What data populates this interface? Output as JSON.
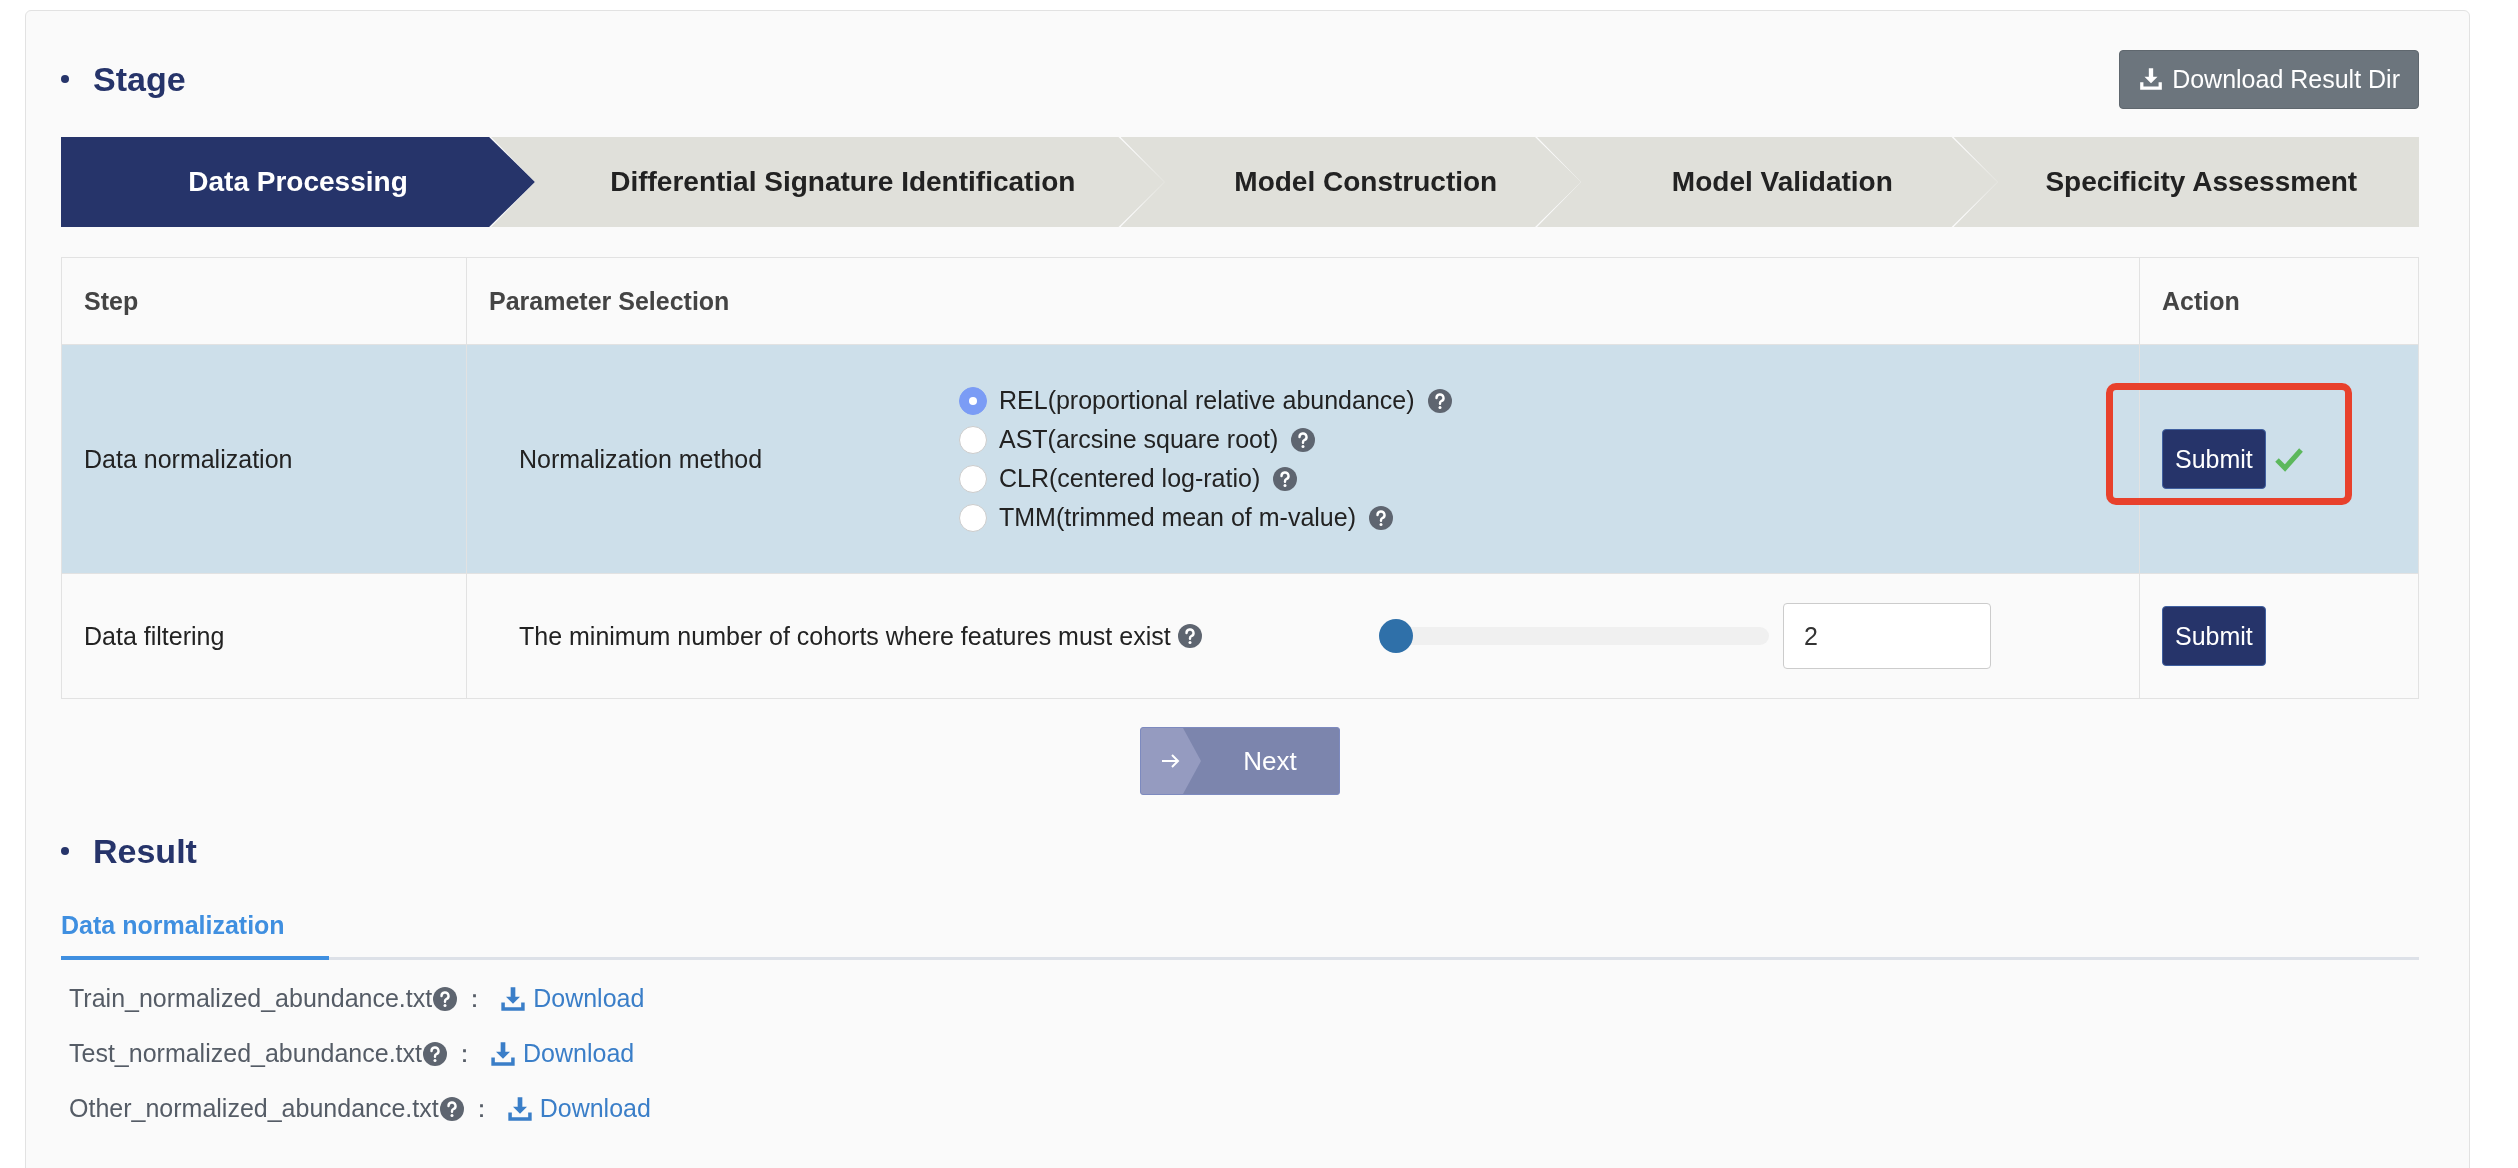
{
  "stage": {
    "title": "Stage",
    "download_button": "Download Result Dir",
    "steps": [
      {
        "label": "Data Processing",
        "selected": true
      },
      {
        "label": "Differential Signature Identification",
        "selected": false
      },
      {
        "label": "Model Construction",
        "selected": false
      },
      {
        "label": "Model Validation",
        "selected": false
      },
      {
        "label": "Specificity Assessment",
        "selected": false
      }
    ],
    "table": {
      "columns": [
        "Step",
        "Parameter Selection",
        "Action"
      ],
      "rows": [
        {
          "kind": "radio",
          "step": "Data normalization",
          "parameter": "Normalization method",
          "highlighted": true,
          "button": "Submit",
          "done": true,
          "highlight_frame": true,
          "options": [
            {
              "label": "REL(proportional relative abundance)",
              "selected": true
            },
            {
              "label": "AST(arcsine square root)",
              "selected": false
            },
            {
              "label": "CLR(centered log-ratio)",
              "selected": false
            },
            {
              "label": "TMM(trimmed mean of m-value)",
              "selected": false
            }
          ]
        },
        {
          "kind": "slider",
          "step": "Data filtering",
          "parameter": "The minimum number of cohorts where features must exist",
          "highlighted": false,
          "button": "Submit",
          "done": false,
          "highlight_frame": false,
          "level": 0,
          "value": "2"
        }
      ]
    },
    "next_button": "Next"
  },
  "result": {
    "title": "Result",
    "tabs": [
      {
        "label": "Data normalization",
        "selected": true
      }
    ],
    "files": [
      {
        "name": "Train_normalized_abundance.txt",
        "separator": "：",
        "link": "Download"
      },
      {
        "name": "Test_normalized_abundance.txt",
        "separator": "：",
        "link": "Download"
      },
      {
        "name": "Other_normalized_abundance.txt",
        "separator": "：",
        "link": "Download"
      }
    ]
  }
}
